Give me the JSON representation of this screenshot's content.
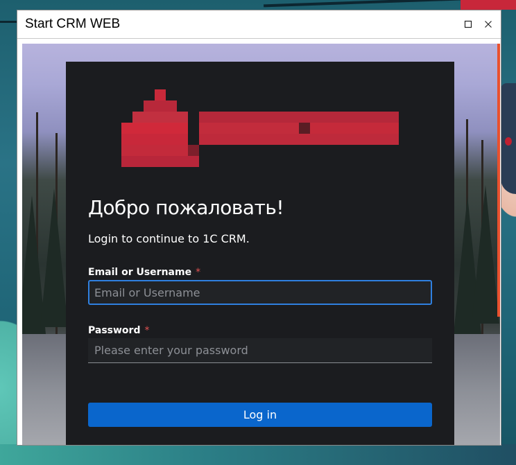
{
  "window": {
    "title": "Start CRM WEB"
  },
  "login": {
    "heading": "Добро пожаловать!",
    "subtitle": "Login to continue to 1C CRM.",
    "username": {
      "label": "Email or Username",
      "required_mark": "*",
      "placeholder": "Email or Username",
      "value": ""
    },
    "password": {
      "label": "Password",
      "required_mark": "*",
      "placeholder": "Please enter your password",
      "value": ""
    },
    "submit_label": "Log in"
  },
  "colors": {
    "card_background": "#1b1c1f",
    "primary_button": "#0a66cc",
    "focus_border": "#2f80e0",
    "required_mark": "#e05252",
    "logo_red": "#c8293a",
    "scroll_accent": "#e8502e"
  },
  "icons": {
    "maximize": "maximize-icon",
    "close": "close-icon",
    "logo": "brand-logo-pixelated"
  }
}
